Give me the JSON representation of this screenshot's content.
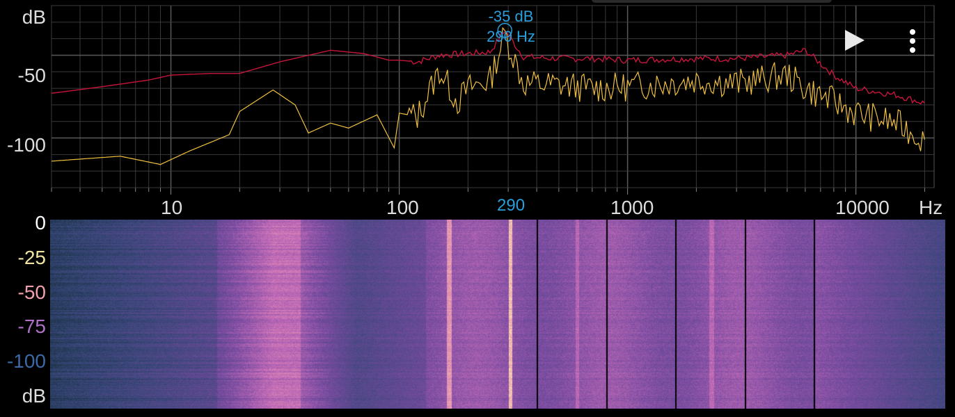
{
  "spectrum": {
    "y_unit_label": "dB",
    "y_ticks": [
      "-50",
      "-100"
    ],
    "x_ticks": [
      "10",
      "100",
      "1000",
      "10000"
    ],
    "x_unit_label": "Hz",
    "cursor_freq_label": "290",
    "peak": {
      "db_label": "-35 dB",
      "hz_label": "290 Hz"
    },
    "colors": {
      "current": "#f0c040",
      "peak_hold": "#c8143c",
      "cursor": "#2a9fdc",
      "grid": "#3a3a3a"
    }
  },
  "spectrogram": {
    "y_ticks": [
      "0",
      "-25",
      "-50",
      "-75",
      "-100"
    ],
    "y_unit_label": "dB",
    "y_tick_colors": [
      "#ffffff",
      "#eee4a0",
      "#f2a0b0",
      "#b070c8",
      "#3c6aa8"
    ]
  },
  "controls": {
    "play_icon": "play-icon",
    "menu_icon": "more-vert-icon"
  },
  "chart_data": {
    "type": "line",
    "xlabel": "Hz",
    "ylabel": "dB",
    "x_scale": "log",
    "xlim": [
      3,
      22000
    ],
    "ylim": [
      -130,
      -20
    ],
    "grid": true,
    "series": [
      {
        "x": [
          3,
          5,
          8,
          10,
          15,
          20,
          30,
          50,
          70,
          90,
          100,
          120,
          150,
          200,
          250,
          290,
          350,
          500,
          700,
          1000,
          2000,
          3000,
          5000,
          6000,
          8000,
          10000,
          15000,
          20000
        ],
        "values": [
          -73,
          -69,
          -65,
          -62,
          -61,
          -61,
          -54,
          -47,
          -49,
          -53,
          -53,
          -54,
          -50,
          -49,
          -48,
          -35,
          -51,
          -52,
          -52,
          -53,
          -52,
          -52,
          -50,
          -47,
          -62,
          -70,
          -74,
          -79
        ]
      },
      {
        "x": [
          3,
          6,
          9,
          12,
          18,
          20,
          28,
          35,
          40,
          50,
          60,
          80,
          95,
          100,
          120,
          150,
          180,
          200,
          250,
          290,
          350,
          500,
          700,
          1000,
          2000,
          3000,
          5000,
          6000,
          8000,
          10000,
          15000,
          20000
        ],
        "values": [
          -114,
          -111,
          -116,
          -108,
          -98,
          -84,
          -71,
          -80,
          -97,
          -91,
          -94,
          -86,
          -106,
          -85,
          -87,
          -59,
          -78,
          -70,
          -65,
          -37,
          -67,
          -68,
          -70,
          -69,
          -65,
          -67,
          -62,
          -70,
          -78,
          -85,
          -91,
          -101
        ]
      }
    ]
  }
}
